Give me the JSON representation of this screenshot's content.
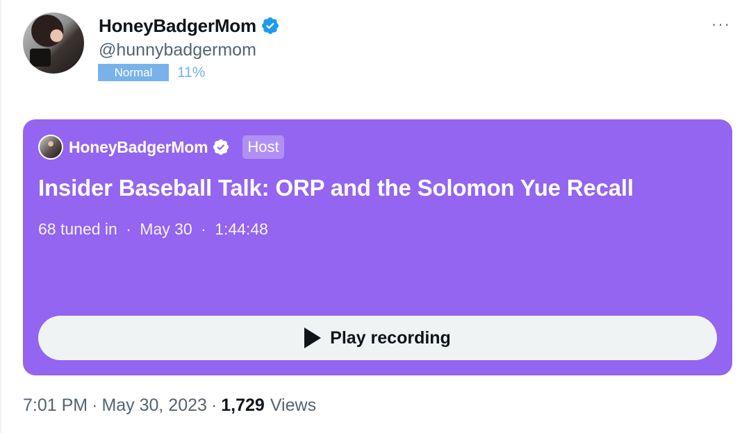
{
  "author": {
    "display_name": "HoneyBadgerMom",
    "handle": "@hunnybadgermom",
    "verified": true,
    "verified_color": "#1d9bf0"
  },
  "extension": {
    "badge_label": "Normal",
    "percentage": "11%",
    "badge_color": "#78b2ea"
  },
  "menu": {
    "more_icon": "more-horizontal-icon",
    "more_glyph": "···"
  },
  "space": {
    "background_color": "#9365f1",
    "host_name": "HoneyBadgerMom",
    "host_badge": "Host",
    "title": "Insider Baseball Talk: ORP and the Solomon Yue Recall",
    "tuned_in": "68 tuned in",
    "date": "May 30",
    "duration": "1:44:48",
    "separator": "·",
    "play_label": "Play recording",
    "play_icon": "play-icon"
  },
  "tweet_meta": {
    "time": "7:01 PM",
    "date": "May 30, 2023",
    "views_count": "1,729",
    "views_label": "Views",
    "separator": "·"
  }
}
